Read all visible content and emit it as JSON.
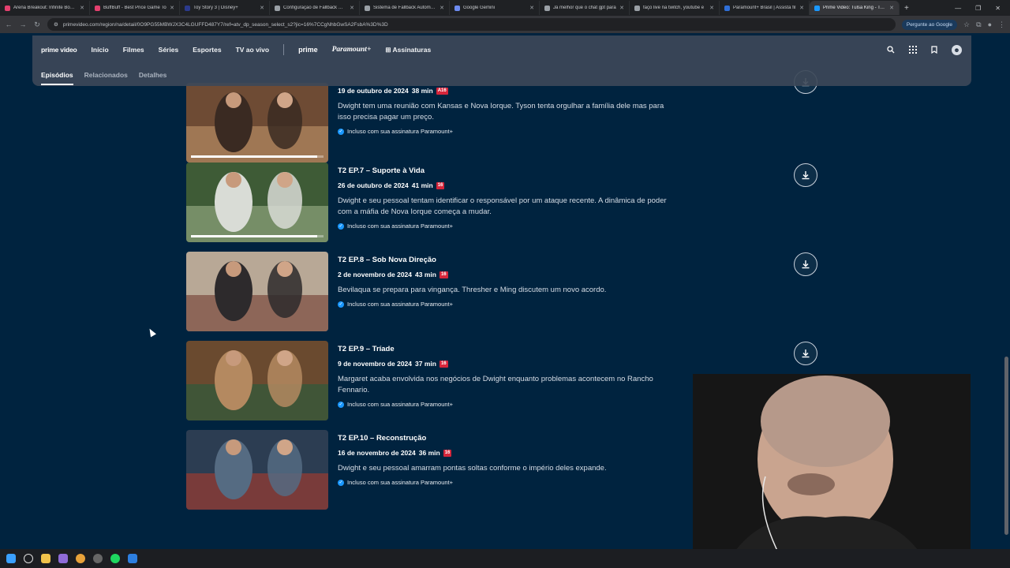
{
  "browser": {
    "tabs": [
      {
        "title": "Arena Breakout: Infinite Bonds",
        "color": "#e4406f"
      },
      {
        "title": "BuffBuff - Best Price Game To",
        "color": "#e4406f"
      },
      {
        "title": "Toy Story 3 | Disney+",
        "color": "#2b3a8c"
      },
      {
        "title": "Configuração de Fallback OBS",
        "color": "#9aa0a6"
      },
      {
        "title": "Sistema de Fallback Automátic",
        "color": "#9aa0a6"
      },
      {
        "title": "Google Gemini",
        "color": "#6d8bf0"
      },
      {
        "title": "Já melhor que o chat gpt para",
        "color": "#9aa0a6"
      },
      {
        "title": "faço live na twitch, youtube e",
        "color": "#9aa0a6"
      },
      {
        "title": "Paramount+ Brasil | Assista fil",
        "color": "#2f6fd8"
      },
      {
        "title": "Prime Video: Tulsa King - Tem",
        "color": "#1a98ff"
      }
    ],
    "url": "primevideo.com/region/na/detail/0O9PG55MBWJX3C4LGUFFD487Y7/ref=atv_dp_season_select_s2?jic=16%7CCgNhbGwSA2FsbA%3D%3D",
    "ask_google": "Pergunte ao Google"
  },
  "header": {
    "logo": "prime video",
    "nav": [
      "Início",
      "Filmes",
      "Séries",
      "Esportes",
      "TV ao vivo"
    ],
    "prime": "prime",
    "paramount": "Paramount+",
    "subscriptions": "Assinaturas",
    "subnav": [
      "Episódios",
      "Relacionados",
      "Detalhes"
    ]
  },
  "episodes": [
    {
      "title": "",
      "date": "19 de outubro de 2024",
      "duration": "38 min",
      "rating": "A16",
      "description": "Dwight tem uma reunião com Kansas e Nova Iorque. Tyson tenta orgulhar a família dele mas para isso precisa pagar um preço.",
      "included": "Incluso com sua assinatura Paramount+",
      "progress": 0.95
    },
    {
      "title": "T2 EP.7 – Suporte à Vida",
      "date": "26 de outubro de 2024",
      "duration": "41 min",
      "rating": "16",
      "description": "Dwight e seu pessoal tentam identificar o responsável por um ataque recente. A dinâmica de poder com a máfia de Nova Iorque começa a mudar.",
      "included": "Incluso com sua assinatura Paramount+",
      "progress": 0.95
    },
    {
      "title": "T2 EP.8 – Sob Nova Direção",
      "date": "2 de novembro de 2024",
      "duration": "43 min",
      "rating": "16",
      "description": "Bevilaqua se prepara para vingança. Thresher e Ming discutem um novo acordo.",
      "included": "Incluso com sua assinatura Paramount+",
      "progress": 0
    },
    {
      "title": "T2 EP.9 – Tríade",
      "date": "9 de novembro de 2024",
      "duration": "37 min",
      "rating": "16",
      "description": "Margaret acaba envolvida nos negócios de Dwight enquanto problemas acontecem no Rancho Fennario.",
      "included": "Incluso com sua assinatura Paramount+",
      "progress": 0
    },
    {
      "title": "T2 EP.10 – Reconstrução",
      "date": "16 de novembro de 2024",
      "duration": "36 min",
      "rating": "16",
      "description": "Dwight e seu pessoal amarram pontas soltas conforme o império deles expande.",
      "included": "Incluso com sua assinatura Paramount+",
      "progress": 0
    }
  ],
  "colors": {
    "page_bg": "#00233f",
    "accent": "#1a98ff",
    "rating": "#d6263b"
  }
}
